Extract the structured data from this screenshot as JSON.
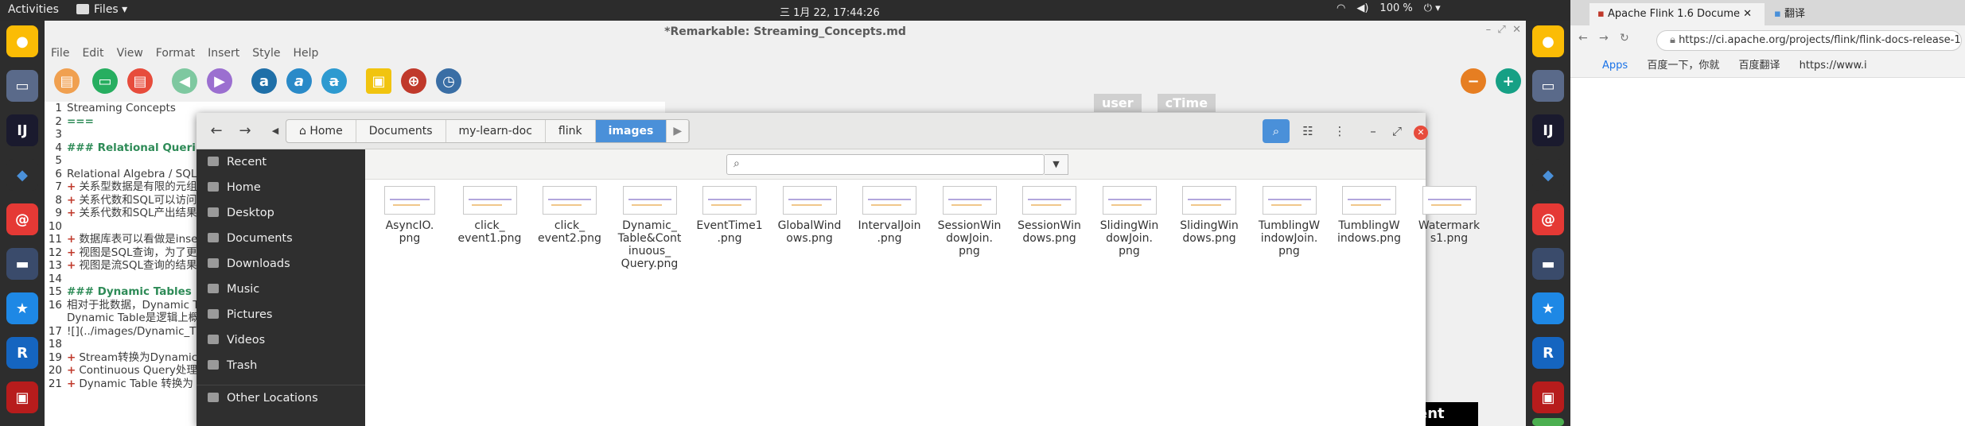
{
  "topbar": {
    "activities": "Activities",
    "app_menu": "Files ▾",
    "clock": "三 1月 22, 17:44:26",
    "battery": "100 %"
  },
  "remarkable": {
    "title": "*Remarkable: Streaming_Concepts.md",
    "menu": [
      "File",
      "Edit",
      "View",
      "Format",
      "Insert",
      "Style",
      "Help"
    ],
    "lines": [
      {
        "n": "1",
        "t": "Streaming Concepts",
        "k": "plain"
      },
      {
        "n": "2",
        "t": "===",
        "k": "hd"
      },
      {
        "n": "3",
        "t": "",
        "k": "plain"
      },
      {
        "n": "4",
        "t": "### Relational Queri",
        "k": "hd"
      },
      {
        "n": "5",
        "t": "",
        "k": "plain"
      },
      {
        "n": "6",
        "t": "Relational Algebra / SQL",
        "k": "plain"
      },
      {
        "n": "7",
        "t": "关系型数据是有限的元组",
        "k": "bullet"
      },
      {
        "n": "8",
        "t": "关系代数和SQL可以访问",
        "k": "bullet"
      },
      {
        "n": "9",
        "t": "关系代数和SQL产出结果",
        "k": "bullet"
      },
      {
        "n": "10",
        "t": "",
        "k": "plain"
      },
      {
        "n": "11",
        "t": "数据库表可以看做是inse",
        "k": "bullet"
      },
      {
        "n": "12",
        "t": "视图是SQL查询，为了更",
        "k": "bullet"
      },
      {
        "n": "13",
        "t": "视图是流SQL查询的结果",
        "k": "bullet"
      },
      {
        "n": "14",
        "t": "",
        "k": "plain"
      },
      {
        "n": "15",
        "t": "### Dynamic Tables",
        "k": "hd"
      },
      {
        "n": "16",
        "t": "相对于批数据，Dynamic T",
        "k": "plain"
      },
      {
        "n": "",
        "t": "Dynamic Table是逻辑上概",
        "k": "plain"
      },
      {
        "n": "17",
        "t": "![](../images/Dynamic_T",
        "k": "plain"
      },
      {
        "n": "18",
        "t": "",
        "k": "plain"
      },
      {
        "n": "19",
        "t": "Stream转换为Dynamic",
        "k": "bullet"
      },
      {
        "n": "20",
        "t": "Continuous Query处理",
        "k": "bullet"
      },
      {
        "n": "21",
        "t": "Dynamic Table 转换为",
        "k": "bullet"
      }
    ],
    "preview_headers": [
      "user",
      "cTime"
    ],
    "preview_fragment": "ent"
  },
  "files": {
    "breadcrumbs": [
      "Home",
      "Documents",
      "my-learn-doc",
      "flink",
      "images"
    ],
    "search_placeholder": "",
    "sidebar": [
      "Recent",
      "Home",
      "Desktop",
      "Documents",
      "Downloads",
      "Music",
      "Pictures",
      "Videos",
      "Trash",
      "Other Locations"
    ],
    "items": [
      [
        "AsyncIO.",
        "png"
      ],
      [
        "click_",
        "event1.png"
      ],
      [
        "click_",
        "event2.png"
      ],
      [
        "Dynamic_",
        "Table&Cont",
        "inuous_",
        "Query.png"
      ],
      [
        "EventTime1",
        ".png"
      ],
      [
        "GlobalWind",
        "ows.png"
      ],
      [
        "IntervalJoin",
        ".png"
      ],
      [
        "SessionWin",
        "dowJoin.",
        "png"
      ],
      [
        "SessionWin",
        "dows.png"
      ],
      [
        "SlidingWin",
        "dowJoin.",
        "png"
      ],
      [
        "SlidingWin",
        "dows.png"
      ],
      [
        "TumblingW",
        "indowJoin.",
        "png"
      ],
      [
        "TumblingW",
        "indows.png"
      ],
      [
        "Watermark",
        "s1.png"
      ]
    ]
  },
  "chrome": {
    "tab1": "Apache Flink 1.6 Docume",
    "tab2": "翻译",
    "url": "https://ci.apache.org/projects/flink/flink-docs-release-1",
    "bookmarks": [
      "Apps",
      "百度一下，你就",
      "百度翻译",
      "https://www.i"
    ]
  },
  "colors": {
    "accent": "#4a90d9",
    "sidebar_bg": "#2f2f2f",
    "heading": "#2e8b57",
    "bullet": "#c0392b"
  }
}
